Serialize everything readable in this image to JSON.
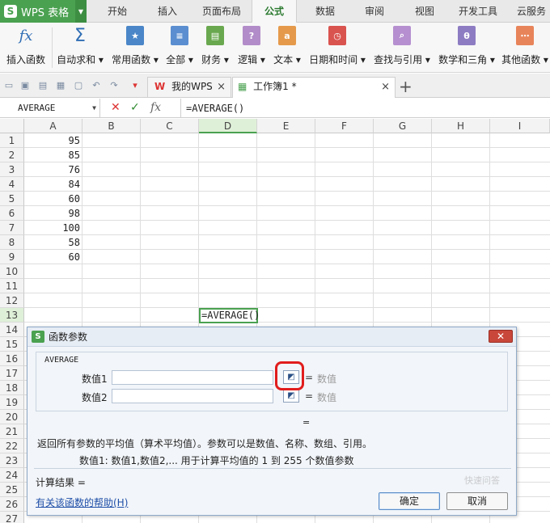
{
  "app": {
    "logo_text": "WPS 表格"
  },
  "menu_tabs": [
    "开始",
    "插入",
    "页面布局",
    "公式",
    "数据",
    "审阅",
    "视图",
    "开发工具",
    "云服务"
  ],
  "active_menu_tab": "公式",
  "ribbon": {
    "insert_function": "插入函数",
    "autosum": "自动求和",
    "common_functions": "常用函数",
    "all": "全部",
    "finance": "财务",
    "logic": "逻辑",
    "text": "文本",
    "datetime": "日期和时间",
    "lookup": "查找与引用",
    "math": "数学和三角",
    "other": "其他函数",
    "icon_texts": {
      "fx": "fx",
      "sigma": "Σ",
      "logic": "?",
      "text": "a",
      "math": "θ"
    }
  },
  "doc_tabs": {
    "my_wps": "我的WPS",
    "workbook": "工作簿1 *"
  },
  "formula_bar": {
    "name_box": "AVERAGE",
    "fx_label": "fx",
    "formula": "=AVERAGE()"
  },
  "columns": [
    "A",
    "B",
    "C",
    "D",
    "E",
    "F",
    "G",
    "H",
    "I"
  ],
  "selected_column": "D",
  "rows": [
    "1",
    "2",
    "3",
    "4",
    "5",
    "6",
    "7",
    "8",
    "9",
    "10",
    "11",
    "12",
    "13",
    "14",
    "15",
    "16",
    "17",
    "18",
    "19",
    "20",
    "21",
    "22",
    "23",
    "24",
    "25",
    "26",
    "27"
  ],
  "selected_row": "13",
  "cells": {
    "a1": "95",
    "a2": "85",
    "a3": "76",
    "a4": "84",
    "a5": "60",
    "a6": "98",
    "a7": "100",
    "a8": "58",
    "a9": "60",
    "d13": "=AVERAGE()"
  },
  "dialog": {
    "title": "函数参数",
    "function_name": "AVERAGE",
    "param1_label": "数值1",
    "param2_label": "数值2",
    "eq": "=",
    "param_value_hint": "数值",
    "result_eq": "=",
    "description": "返回所有参数的平均值（算术平均值）。参数可以是数值、名称、数组、引用。",
    "param_description": "数值1:  数值1,数值2,... 用于计算平均值的 1 到 255 个数值参数",
    "result_label": "计算结果 =",
    "help_link": "有关该函数的帮助(H)",
    "ok": "确定",
    "cancel": "取消"
  },
  "watermark": "快速问答"
}
